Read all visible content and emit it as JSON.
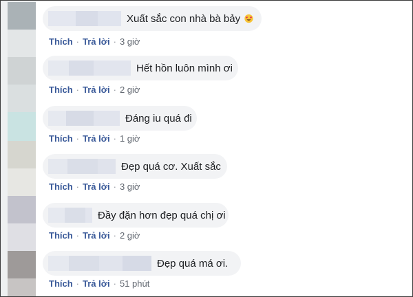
{
  "comments": [
    {
      "text": "Xuất sắc con nhà bà bảy",
      "emoji_icon": "heart-eyes-emoji",
      "like_label": "Thích",
      "reply_label": "Trả lời",
      "time": "3 giờ",
      "avatar_color": "#aab2b6"
    },
    {
      "text": "Hết hồn luôn mình ơi",
      "like_label": "Thích",
      "reply_label": "Trả lời",
      "time": "2 giờ",
      "avatar_color": "#cfd3d4"
    },
    {
      "text": "Đáng iu quá đi",
      "like_label": "Thích",
      "reply_label": "Trả lời",
      "time": "1 giờ",
      "avatar_color": "#c9e3e2"
    },
    {
      "text": "Đẹp quá cơ. Xuất sắc",
      "like_label": "Thích",
      "reply_label": "Trả lời",
      "time": "3 giờ",
      "avatar_color": "#d6d6cf"
    },
    {
      "text": "Đầy đặn hơn đẹp quá chị ơi",
      "like_label": "Thích",
      "reply_label": "Trả lời",
      "time": "2 giờ",
      "avatar_color": "#c2c2cc"
    },
    {
      "text": "Đẹp quá má ơi.",
      "like_label": "Thích",
      "reply_label": "Trả lời",
      "time": "51 phút",
      "avatar_color": "#9e9a99"
    }
  ]
}
